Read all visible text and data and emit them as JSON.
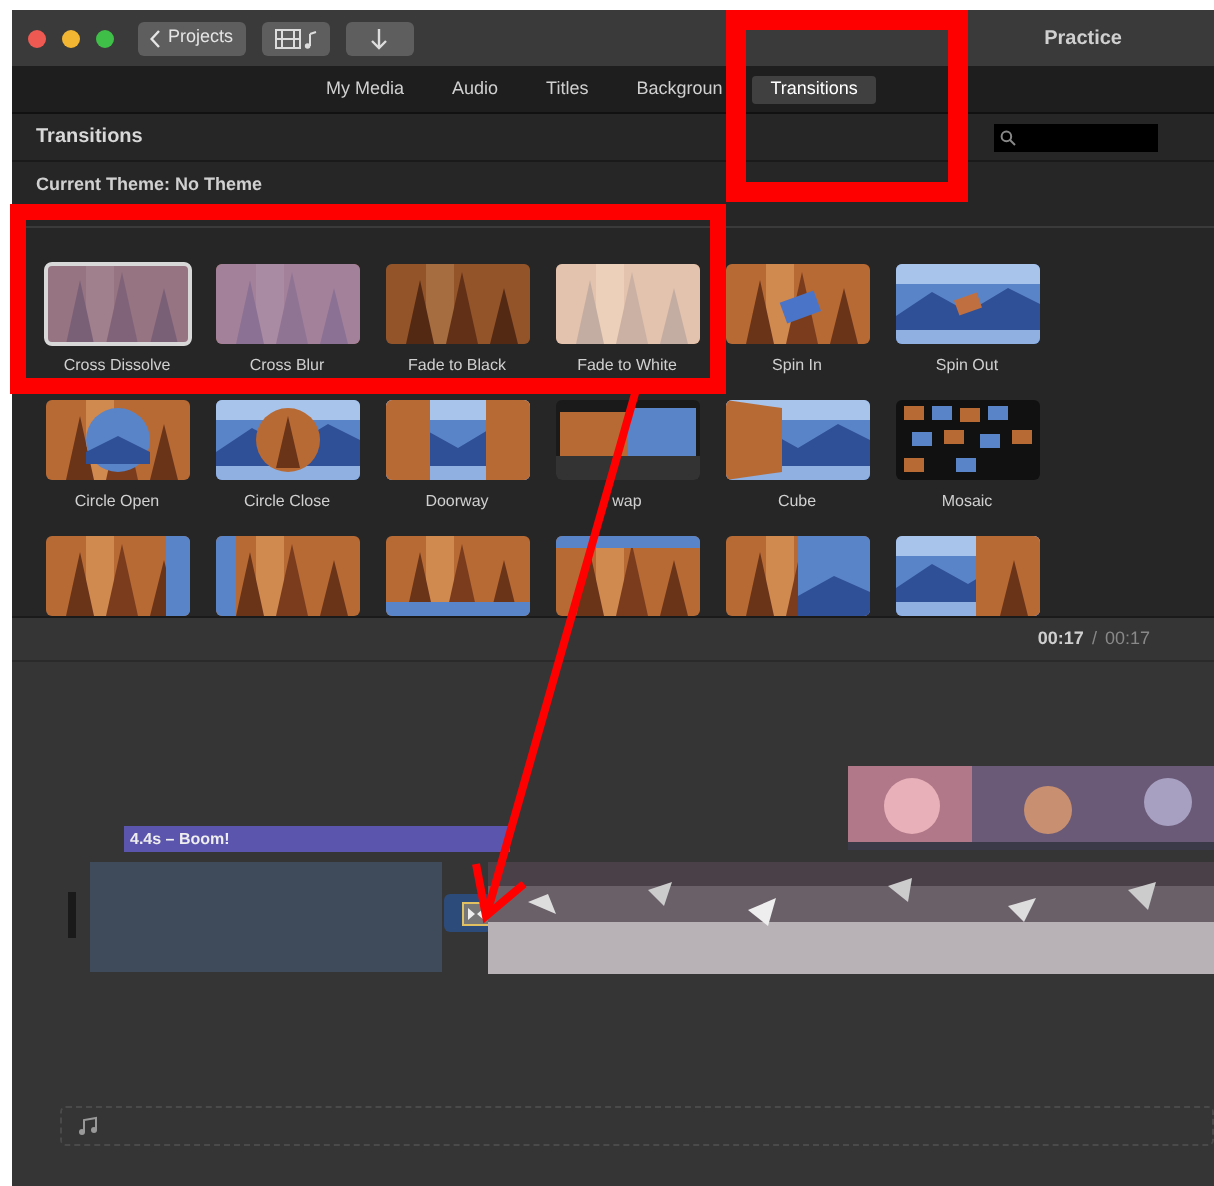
{
  "window": {
    "title": "Practice"
  },
  "toolbar": {
    "back_button": "Projects"
  },
  "tabs": [
    {
      "label": "My Media",
      "selected": false
    },
    {
      "label": "Audio",
      "selected": false
    },
    {
      "label": "Titles",
      "selected": false
    },
    {
      "label": "Backgroun",
      "selected": false
    },
    {
      "label": "Transitions",
      "selected": true
    }
  ],
  "browser": {
    "title": "Transitions",
    "current_theme": "Current Theme: No Theme",
    "transitions": [
      {
        "label": "Cross Dissolve",
        "selected": true
      },
      {
        "label": "Cross Blur",
        "selected": false
      },
      {
        "label": "Fade to Black",
        "selected": false
      },
      {
        "label": "Fade to White",
        "selected": false
      },
      {
        "label": "Spin In",
        "selected": false
      },
      {
        "label": "Spin Out",
        "selected": false
      },
      {
        "label": "Circle Open",
        "selected": false
      },
      {
        "label": "Circle Close",
        "selected": false
      },
      {
        "label": "Doorway",
        "selected": false
      },
      {
        "label": "wap",
        "selected": false
      },
      {
        "label": "Cube",
        "selected": false
      },
      {
        "label": "Mosaic",
        "selected": false
      }
    ]
  },
  "timeline": {
    "time_current": "00:17",
    "separator": "/",
    "time_total": "00:17",
    "title_clip": "4.4s – Boom!"
  }
}
